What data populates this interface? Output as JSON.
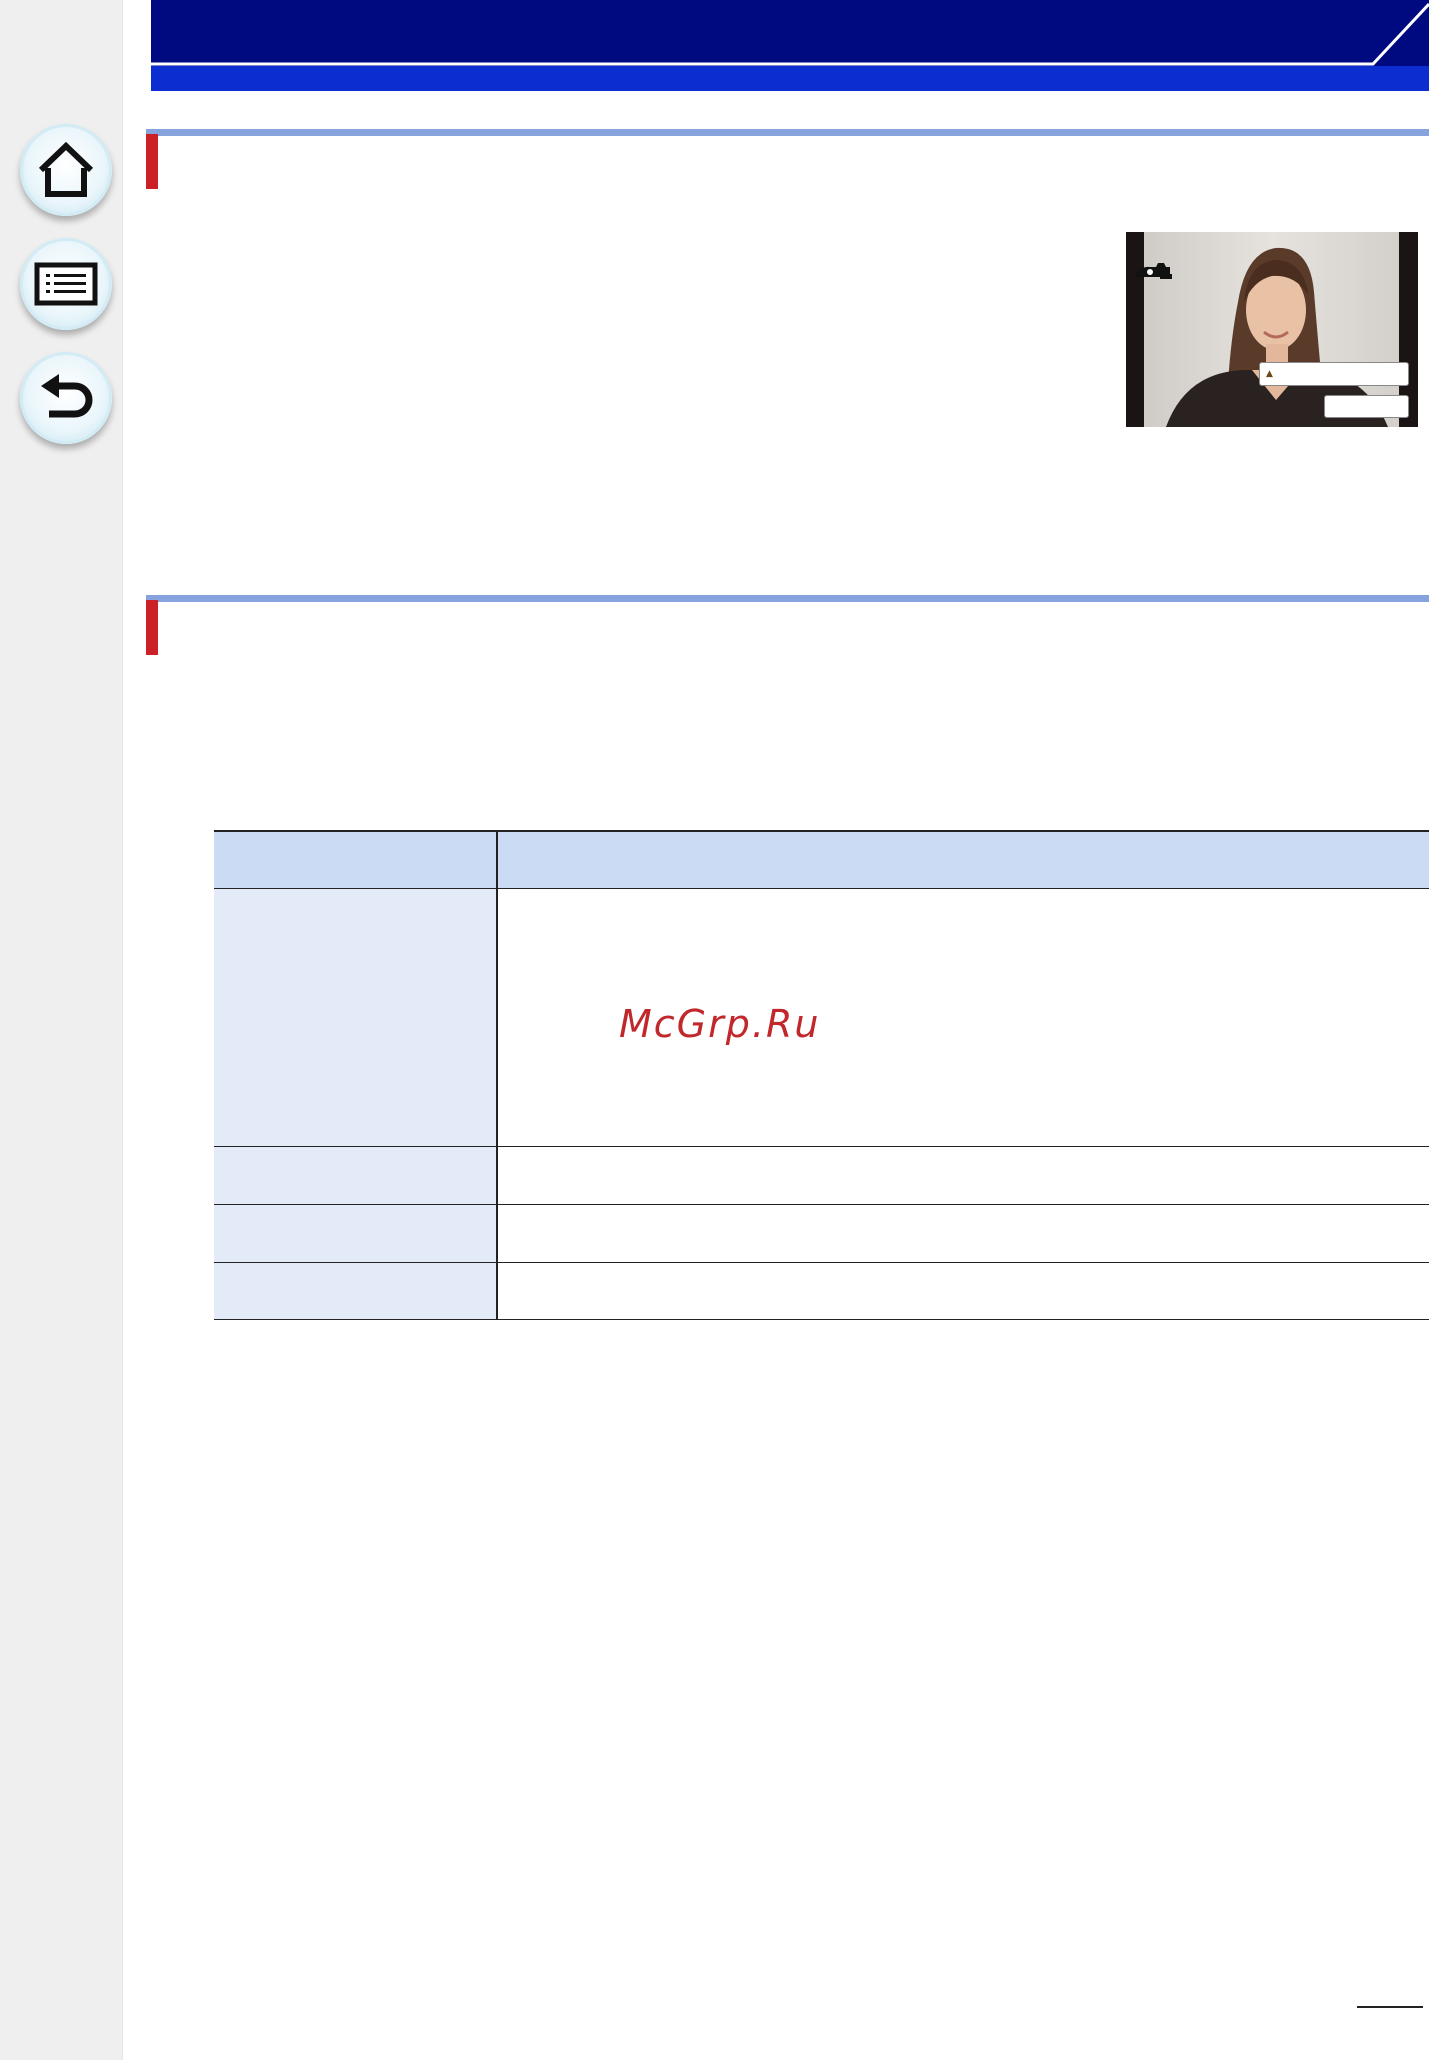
{
  "sidebar": {
    "buttons": [
      {
        "icon": "home-icon"
      },
      {
        "icon": "contents-list-icon"
      },
      {
        "icon": "back-arrow-icon"
      }
    ]
  },
  "header": {
    "color": "#0c2ed0",
    "accent_line_color": "#ffffff"
  },
  "sections": [
    {
      "rule_color": "#86a3de",
      "marker_color": "#cc2027"
    },
    {
      "rule_color": "#86a3de",
      "marker_color": "#cc2027"
    }
  ],
  "camera_screen": {
    "icons": [
      "camera-icon",
      "print-icon",
      "caret-up-icon"
    ]
  },
  "table": {
    "header_color": "#cbdbf3",
    "label_color": "#e3ebf8",
    "rows": 4
  },
  "watermark": "McGrp.Ru"
}
